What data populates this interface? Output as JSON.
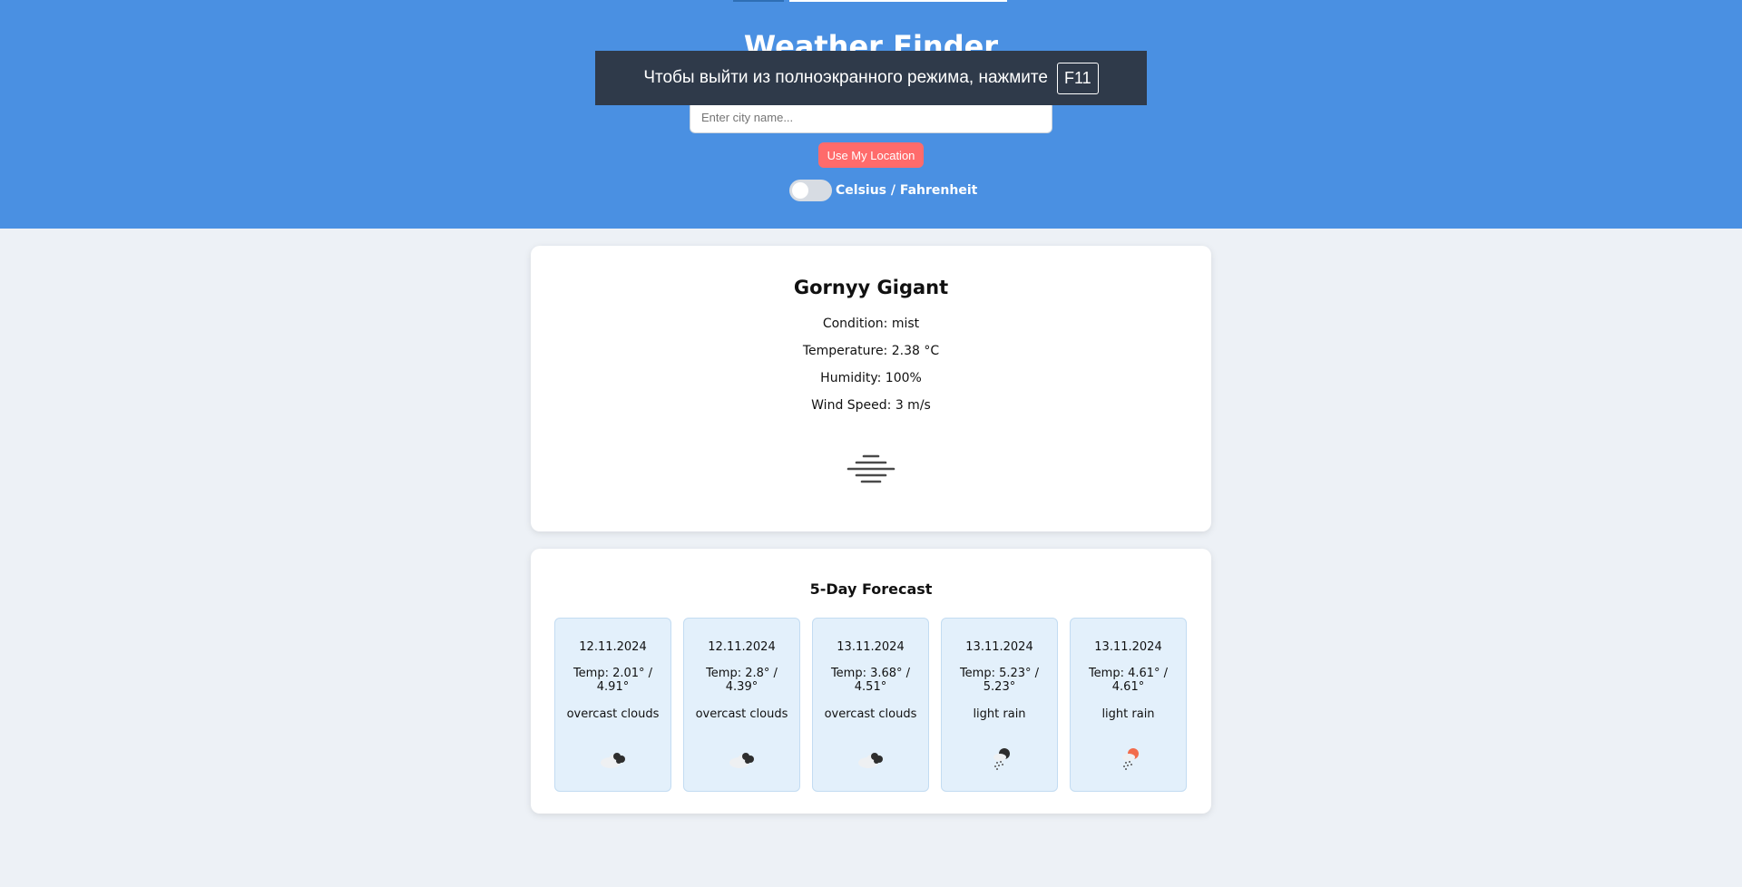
{
  "header": {
    "title": "Weather Finder",
    "search": {
      "placeholder": "Enter city name...",
      "value": ""
    },
    "location_button": "Use My Location",
    "unit_toggle_label": "Celsius / Fahrenheit"
  },
  "fullscreen_notice": {
    "text": "Чтобы выйти из полноэкранного режима, нажмите",
    "key": "F11"
  },
  "current": {
    "city": "Gornyy Gigant",
    "condition": "Condition: mist",
    "temperature": "Temperature: 2.38 °C",
    "humidity": "Humidity: 100%",
    "wind": "Wind Speed: 3 m/s",
    "icon": "mist-icon"
  },
  "forecast": {
    "title": "5-Day Forecast",
    "days": [
      {
        "date": "12.11.2024",
        "temp": "Temp: 2.01° / 4.91°",
        "desc": "overcast clouds",
        "icon": "overcast-clouds-icon"
      },
      {
        "date": "12.11.2024",
        "temp": "Temp: 2.8° / 4.39°",
        "desc": "overcast clouds",
        "icon": "overcast-clouds-icon"
      },
      {
        "date": "13.11.2024",
        "temp": "Temp: 3.68° / 4.51°",
        "desc": "overcast clouds",
        "icon": "overcast-clouds-icon"
      },
      {
        "date": "13.11.2024",
        "temp": "Temp: 5.23° / 5.23°",
        "desc": "light rain",
        "icon": "light-rain-night-icon"
      },
      {
        "date": "13.11.2024",
        "temp": "Temp: 4.61° / 4.61°",
        "desc": "light rain",
        "icon": "light-rain-day-icon"
      }
    ]
  },
  "colors": {
    "header": "#4a90e2",
    "button": "#ff6b6b",
    "forecast_card": "#e3f0fb",
    "background": "#edf1f6"
  }
}
